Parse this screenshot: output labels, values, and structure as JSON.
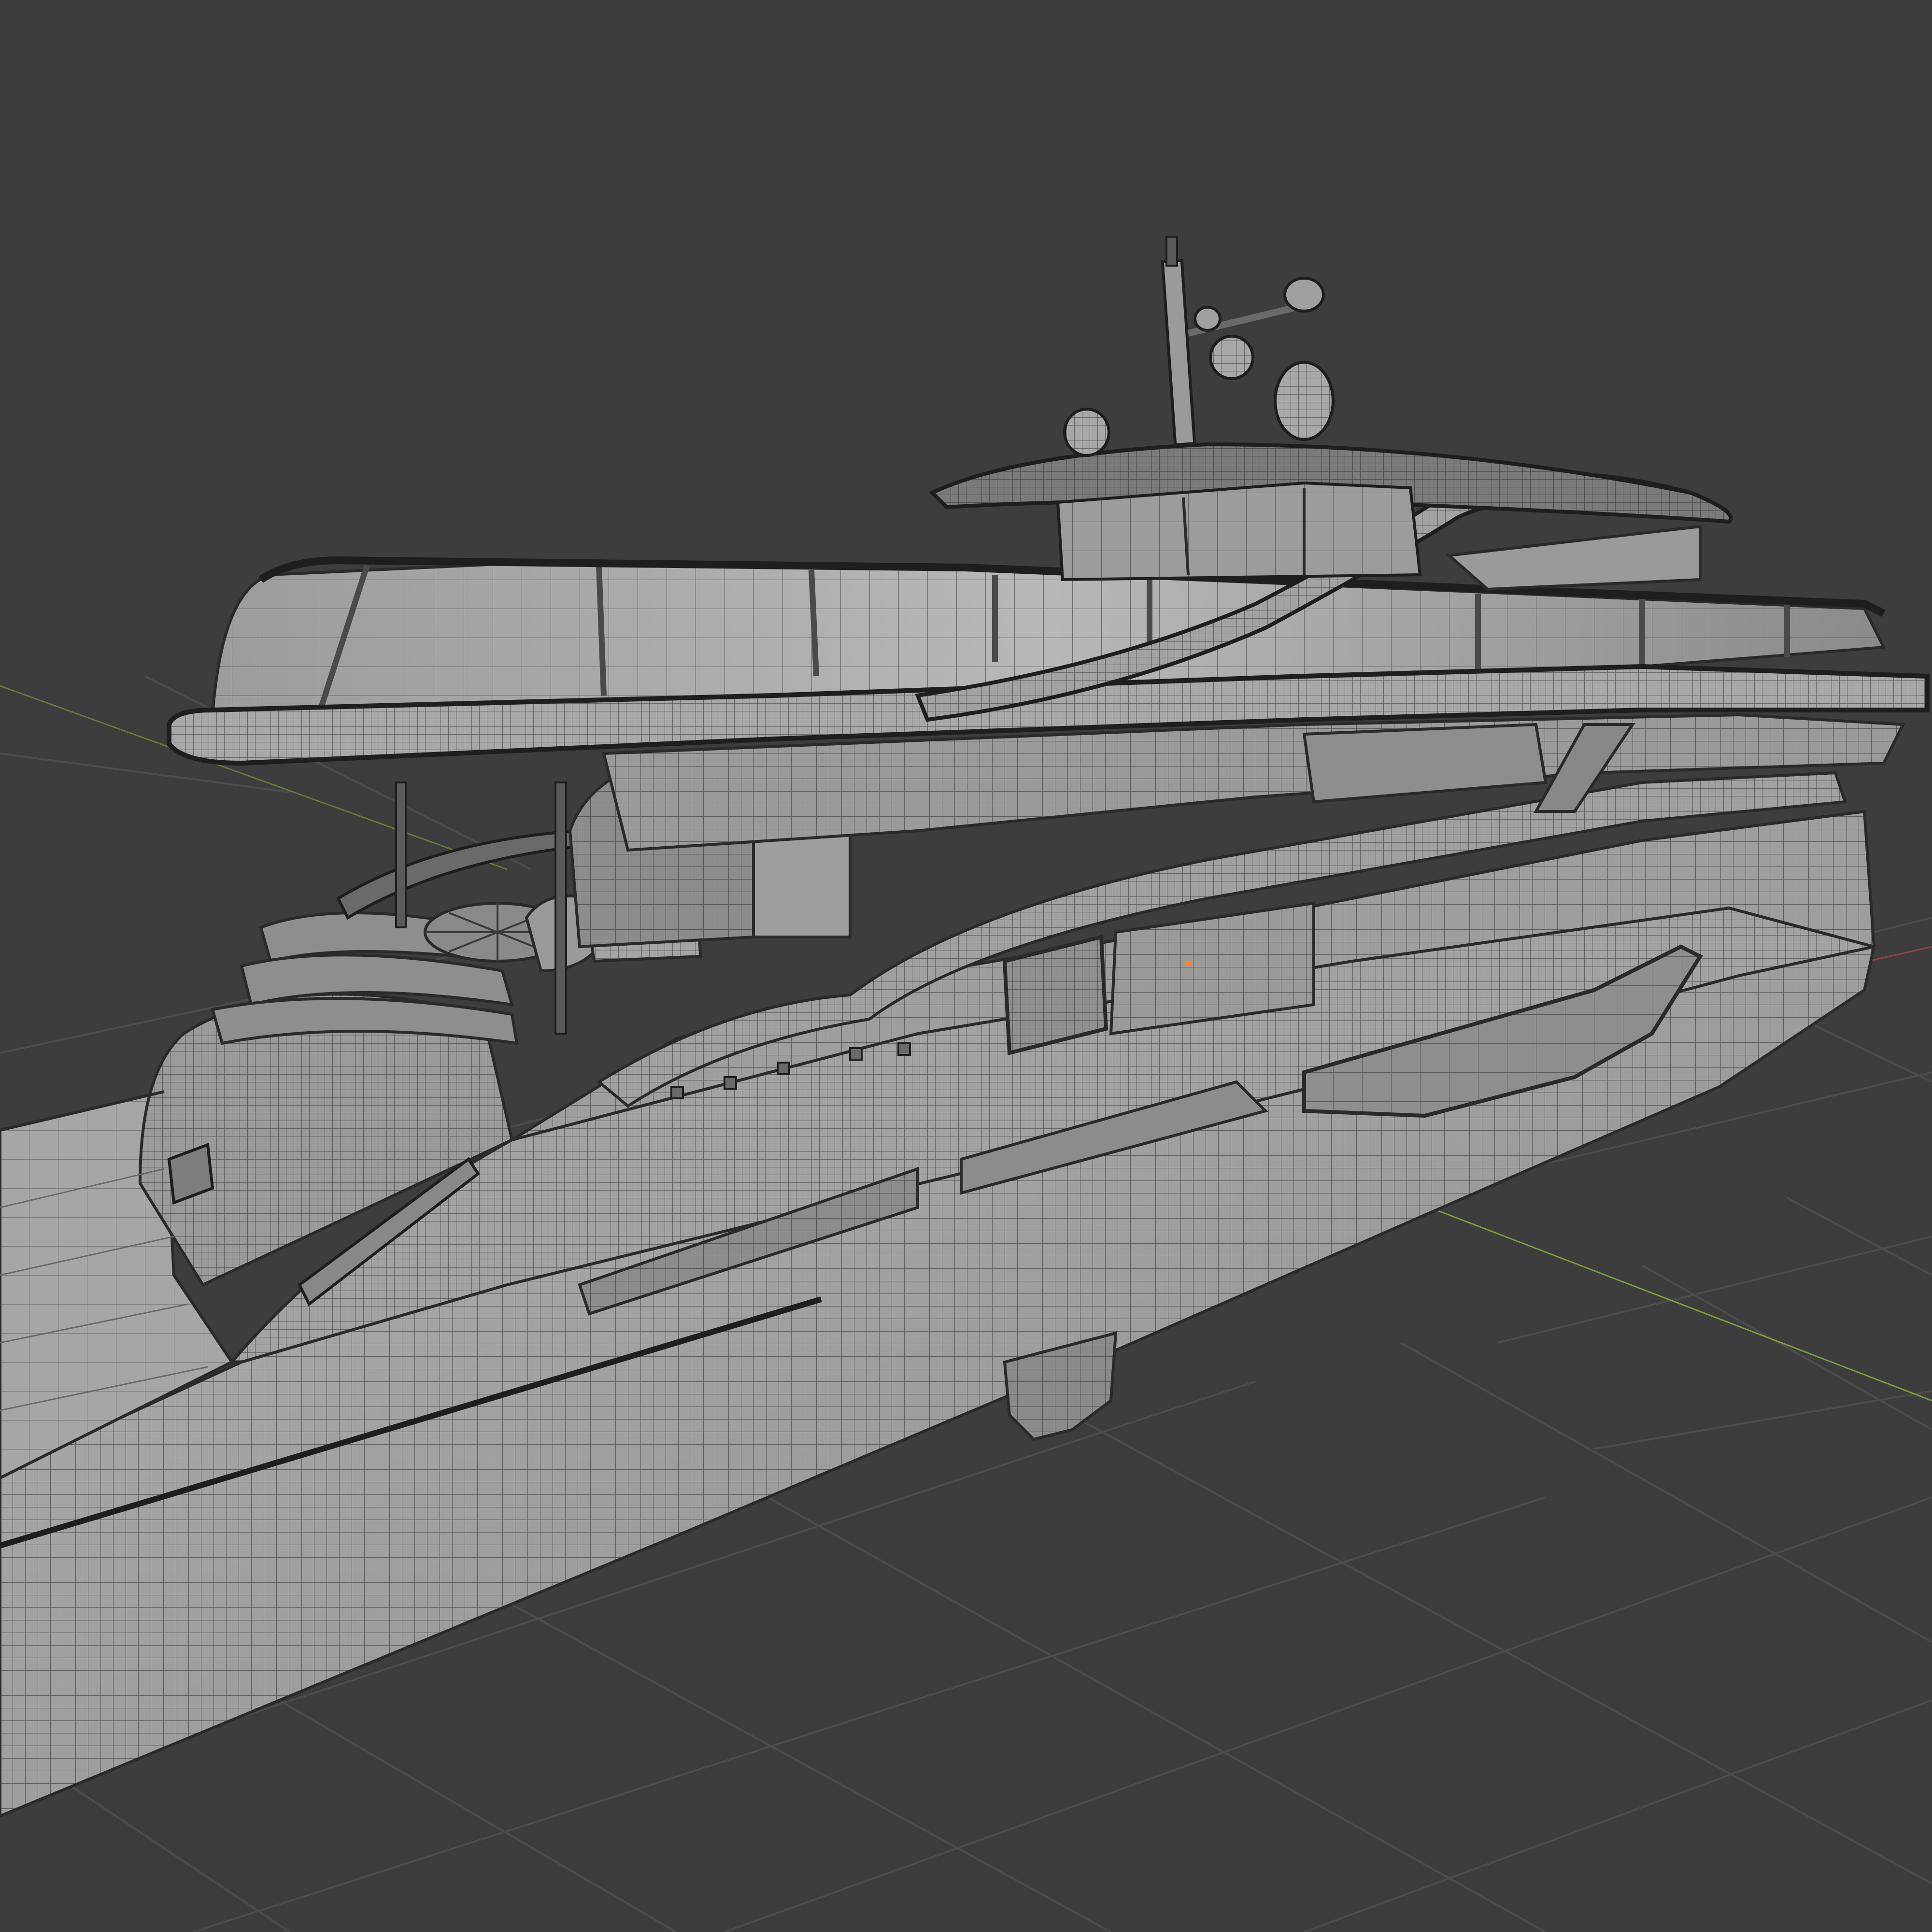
{
  "viewport": {
    "mode": "3d-viewport-wireframe-overlay",
    "object": "motor-yacht-model",
    "background_color": "#3d3d3d",
    "grid_color": "#4c4c4c",
    "x_axis_color": "#b84a4a",
    "y_axis_color": "#8ab83a",
    "mesh_fill_light": "#a8a8a8",
    "mesh_fill_mid": "#8c8c8c",
    "mesh_fill_dark": "#6a6a6a",
    "wire_color": "#2a2a2a",
    "origin_dot_color": "#ff8a1a",
    "shading": "solid-with-wireframe",
    "floor_grid": true
  }
}
